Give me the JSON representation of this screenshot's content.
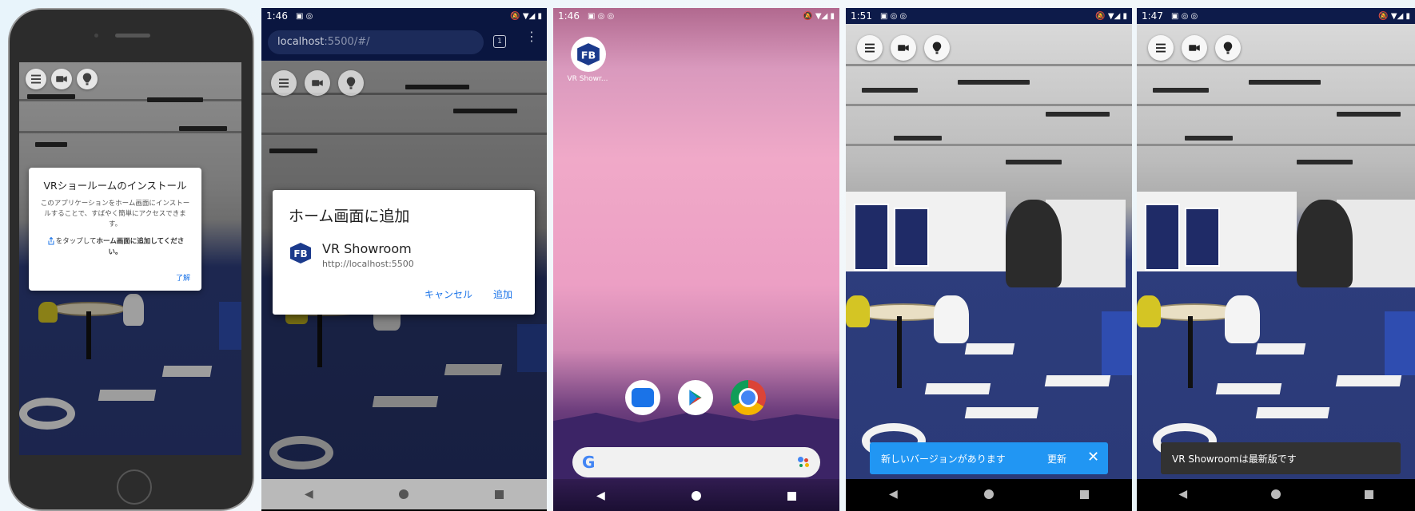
{
  "colors": {
    "dialog_button": "#1a73e8",
    "snackbar_blue": "#2196f3",
    "snackbar_dark": "#323232",
    "status_bar": "#0d1b4a"
  },
  "panel1": {
    "dialog": {
      "title": "VRショールームのインストール",
      "body": "このアプリケーションをホーム画面にインストールすることで、すばやく簡単にアクセスできます。",
      "hint_prefix": "をタップして",
      "hint_bold": "ホーム画面に追加してください。",
      "ok": "了解"
    }
  },
  "panel2": {
    "status": {
      "time": "1:46"
    },
    "browser": {
      "url_host": "localhost",
      "url_rest": ":5500/#/",
      "tab_count": "1"
    },
    "dialog": {
      "title": "ホーム画面に追加",
      "app_name": "VR Showroom",
      "app_url": "http://localhost:5500",
      "cancel": "キャンセル",
      "add": "追加"
    }
  },
  "panel3": {
    "status": {
      "time": "1:46"
    },
    "shortcut_label": "VR Showr..."
  },
  "panel4": {
    "status": {
      "time": "1:51"
    },
    "snackbar": {
      "message": "新しいバージョンがあります",
      "action": "更新"
    }
  },
  "panel5": {
    "status": {
      "time": "1:47"
    },
    "snackbar": {
      "message": "VR Showroomは最新版です"
    }
  }
}
